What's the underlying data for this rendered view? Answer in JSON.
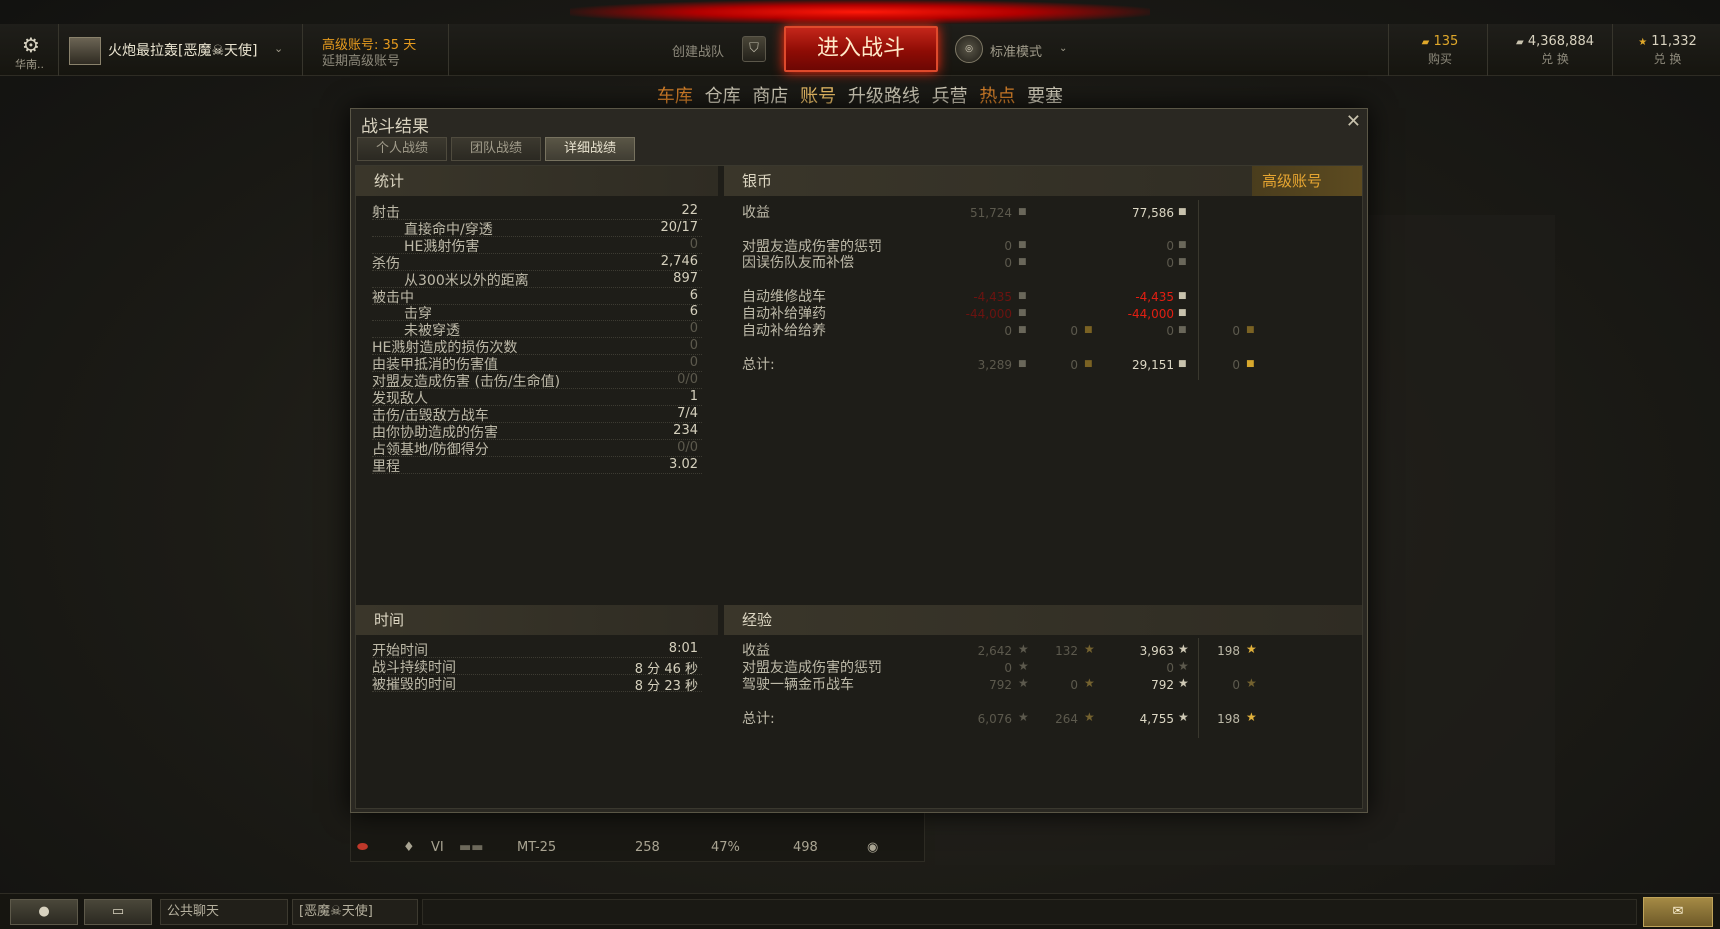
{
  "topbar": {
    "server": "华南..",
    "player_name": "火炮最拉轰[恶魔☠天使]",
    "premium_label": "高级账号:",
    "premium_days": "35 天",
    "premium_extend": "延期高级账号",
    "create_squad": "创建战队",
    "battle_button": "进入战斗",
    "mode_label": "标准模式",
    "gold_value": "135",
    "gold_action": "购买",
    "credits_value": "4,368,884",
    "credits_action": "兑 换",
    "freexp_value": "11,332",
    "freexp_action": "兑 换"
  },
  "nav": [
    "车库",
    "仓库",
    "商店",
    "账号",
    "升级路线",
    "兵营",
    "热点",
    "要塞"
  ],
  "dialog": {
    "title": "战斗结果",
    "close": "✕",
    "tabs": [
      "个人战绩",
      "团队战绩",
      "详细战绩"
    ],
    "stats": {
      "header": "统计",
      "rows": [
        {
          "label": "射击",
          "value": "22"
        },
        {
          "label": "直接命中/穿透",
          "value": "20/17"
        },
        {
          "label": "HE溅射伤害",
          "value": "0"
        },
        {
          "label": "杀伤",
          "value": "2,746"
        },
        {
          "label": "从300米以外的距离",
          "value": "897"
        },
        {
          "label": "被击中",
          "value": "6"
        },
        {
          "label": "击穿",
          "value": "6"
        },
        {
          "label": "未被穿透",
          "value": "0"
        },
        {
          "label": "HE溅射造成的损伤次数",
          "value": "0"
        },
        {
          "label": "由装甲抵消的伤害值",
          "value": "0"
        },
        {
          "label": "对盟友造成伤害 (击伤/生命值)",
          "value": "0/0"
        },
        {
          "label": "发现敌人",
          "value": "1"
        },
        {
          "label": "击伤/击毁敌方战车",
          "value": "7/4"
        },
        {
          "label": "由你协助造成的伤害",
          "value": "234"
        },
        {
          "label": "占领基地/防御得分",
          "value": "0/0"
        },
        {
          "label": "里程",
          "value": "3.02"
        }
      ]
    },
    "credits": {
      "header": "银币",
      "premium_header": "高级账号",
      "income_label": "收益",
      "income": "51,724",
      "income_prem": "77,586",
      "penalty_label": "对盟友造成伤害的惩罚",
      "penalty": "0",
      "penalty_prem": "0",
      "comp_label": "因误伤队友而补偿",
      "comp": "0",
      "comp_prem": "0",
      "repair_label": "自动维修战车",
      "repair": "-4,435",
      "repair_prem": "-4,435",
      "ammo_label": "自动补给弹药",
      "ammo": "-44,000",
      "ammo_prem": "-44,000",
      "equip_label": "自动补给给养",
      "equip": "0",
      "equip_gold": "0",
      "equip_prem": "0",
      "equip_prem_gold": "0",
      "total_label": "总计:",
      "total": "3,289",
      "total_gold": "0",
      "total_prem": "29,151",
      "total_prem_gold": "0"
    },
    "time": {
      "header": "时间",
      "rows": [
        {
          "label": "开始时间",
          "value": "8:01"
        },
        {
          "label": "战斗持续时间",
          "value": "8 分 46 秒"
        },
        {
          "label": "被摧毁的时间",
          "value": "8 分 23 秒"
        }
      ]
    },
    "xp": {
      "header": "经验",
      "income_label": "收益",
      "income": "2,642",
      "income_free": "132",
      "income_prem": "3,963",
      "income_prem_free": "198",
      "penalty_label": "对盟友造成伤害的惩罚",
      "penalty": "0",
      "penalty_prem": "0",
      "gold_tank_label": "驾驶一辆金币战车",
      "gold_tank": "792",
      "gold_tank_free": "0",
      "gold_tank_prem": "792",
      "gold_tank_prem_free": "0",
      "total_label": "总计:",
      "total": "6,076",
      "total_free": "264",
      "total_prem": "4,755",
      "total_prem_free": "198"
    }
  },
  "under_list": {
    "row": {
      "tier": "VI",
      "tank": "MT-25",
      "damage": "258",
      "percent": "47%",
      "xp": "498"
    }
  },
  "bottombar": {
    "channel_public": "公共聊天",
    "channel_clan": "[恶魔☠天使]"
  }
}
